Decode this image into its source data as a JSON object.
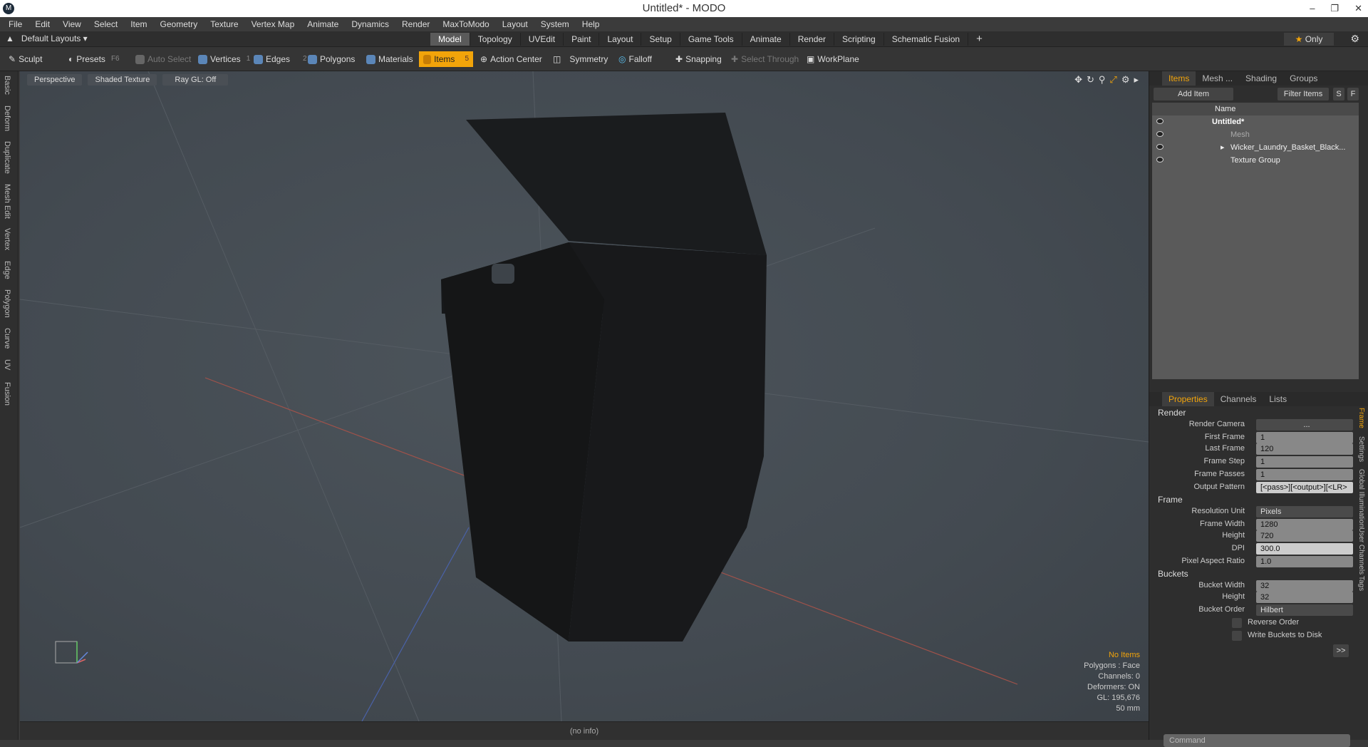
{
  "app": {
    "title": "Untitled* - MODO",
    "logo": "M"
  },
  "menu": [
    "File",
    "Edit",
    "View",
    "Select",
    "Item",
    "Geometry",
    "Texture",
    "Vertex Map",
    "Animate",
    "Dynamics",
    "Render",
    "MaxToModo",
    "Layout",
    "System",
    "Help"
  ],
  "layouts": {
    "label": "Default Layouts ▾"
  },
  "tabs": [
    "Model",
    "Topology",
    "UVEdit",
    "Paint",
    "Layout",
    "Setup",
    "Game Tools",
    "Animate",
    "Render",
    "Scripting",
    "Schematic Fusion"
  ],
  "only_label": "Only",
  "toolbar": {
    "sculpt": "Sculpt",
    "presets": "Presets",
    "presets_key": "F6",
    "auto_select": "Auto Select",
    "vertices": "Vertices",
    "vertices_count": "1",
    "edges": "Edges",
    "edges_count": "2",
    "polygons": "Polygons",
    "materials": "Materials",
    "items": "Items",
    "items_count": "5",
    "action_center": "Action Center",
    "symmetry": "Symmetry",
    "falloff": "Falloff",
    "snapping": "Snapping",
    "select_through": "Select Through",
    "workplane": "WorkPlane"
  },
  "left_tabs": [
    "Basic",
    "Deform",
    "Duplicate",
    "Mesh Edit",
    "Vertex",
    "Edge",
    "Polygon",
    "Curve",
    "UV",
    "Fusion"
  ],
  "viewport": {
    "view": "Perspective",
    "shading": "Shaded Texture",
    "raygl": "Ray GL: Off",
    "stats": {
      "no_items": "No Items",
      "polygons": "Polygons : Face",
      "channels": "Channels: 0",
      "deformers": "Deformers: ON",
      "gl": "GL: 195,676",
      "focal": "50 mm"
    }
  },
  "status": "(no info)",
  "items_panel": {
    "tabs": [
      "Items",
      "Mesh ...",
      "Shading",
      "Groups"
    ],
    "add_item": "Add Item",
    "filter": "Filter Items",
    "s_btn": "S",
    "f_btn": "F",
    "col_name": "Name",
    "rows": [
      {
        "label": "Untitled*"
      },
      {
        "label": "Mesh"
      },
      {
        "label": "Wicker_Laundry_Basket_Black..."
      },
      {
        "label": "Texture Group"
      }
    ]
  },
  "props_panel": {
    "tabs": [
      "Properties",
      "Channels",
      "Lists"
    ],
    "sec_render": "Render",
    "render_camera": {
      "label": "Render Camera",
      "value": "..."
    },
    "first_frame": {
      "label": "First Frame",
      "value": "1"
    },
    "last_frame": {
      "label": "Last Frame",
      "value": "120"
    },
    "frame_step": {
      "label": "Frame Step",
      "value": "1"
    },
    "frame_passes": {
      "label": "Frame Passes",
      "value": "1"
    },
    "output_pattern": {
      "label": "Output Pattern",
      "value": "[<pass>][<output>][<LR>"
    },
    "sec_frame": "Frame",
    "resolution_unit": {
      "label": "Resolution Unit",
      "value": "Pixels"
    },
    "frame_width": {
      "label": "Frame Width",
      "value": "1280"
    },
    "height": {
      "label": "Height",
      "value": "720"
    },
    "dpi": {
      "label": "DPI",
      "value": "300.0"
    },
    "pixel_aspect": {
      "label": "Pixel Aspect Ratio",
      "value": "1.0"
    },
    "sec_buckets": "Buckets",
    "bucket_width": {
      "label": "Bucket Width",
      "value": "32"
    },
    "bucket_height": {
      "label": "Height",
      "value": "32"
    },
    "bucket_order": {
      "label": "Bucket Order",
      "value": "Hilbert"
    },
    "reverse_order": "Reverse Order",
    "write_buckets": "Write Buckets to Disk",
    "more": ">>",
    "side_tabs": [
      "Frame",
      "Settings",
      "Global Illumination",
      "User Channels",
      "Tags"
    ]
  },
  "command_placeholder": "Command"
}
